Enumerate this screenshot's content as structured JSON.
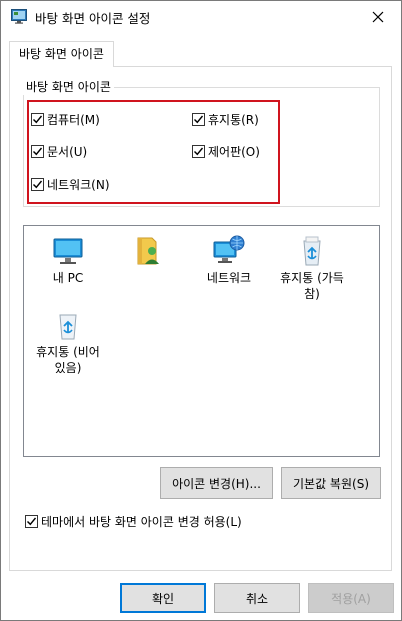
{
  "window": {
    "title": "바탕 화면 아이콘 설정",
    "close_symbol": "✕"
  },
  "tab": {
    "label": "바탕 화면 아이콘"
  },
  "group": {
    "legend": "바탕 화면 아이콘",
    "checkboxes": [
      {
        "label": "컴퓨터(M)",
        "checked": true
      },
      {
        "label": "휴지통(R)",
        "checked": true
      },
      {
        "label": "문서(U)",
        "checked": true
      },
      {
        "label": "제어판(O)",
        "checked": true
      },
      {
        "label": "네트워크(N)",
        "checked": true
      }
    ]
  },
  "icons": [
    {
      "label": "내 PC",
      "icon": "computer-icon"
    },
    {
      "label": "",
      "icon": "user-folder-icon"
    },
    {
      "label": "네트워크",
      "icon": "network-icon"
    },
    {
      "label": "휴지통 (가득 참)",
      "icon": "recycle-bin-full-icon"
    },
    {
      "label": "휴지통 (비어 있음)",
      "icon": "recycle-bin-empty-icon"
    }
  ],
  "buttons": {
    "change_icon": "아이콘 변경(H)...",
    "restore_default": "기본값 복원(S)",
    "ok": "확인",
    "cancel": "취소",
    "apply": "적용(A)"
  },
  "theme_checkbox": {
    "label": "테마에서 바탕 화면 아이콘 변경 허용(L)",
    "checked": true
  },
  "colors": {
    "highlight": "#d0141e",
    "primary_border": "#0078d7"
  }
}
